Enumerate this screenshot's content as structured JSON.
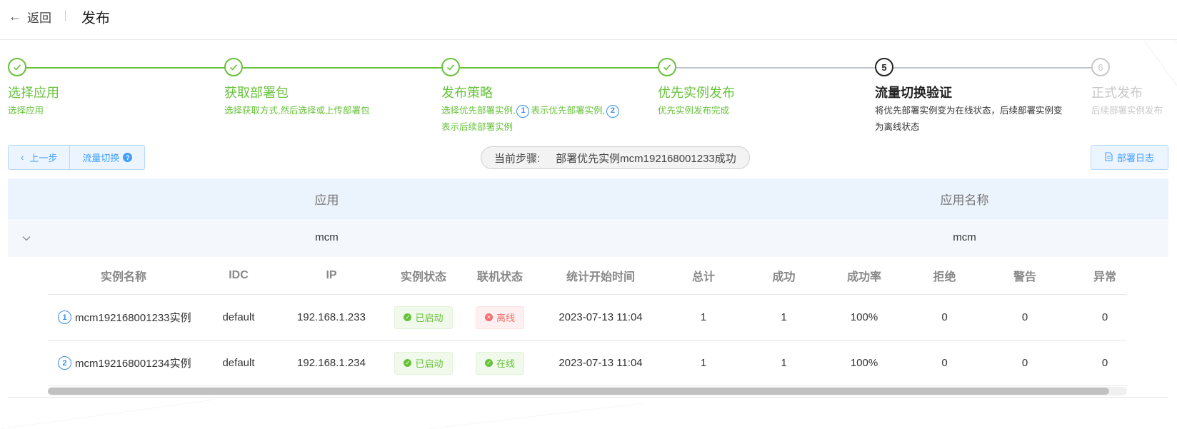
{
  "header": {
    "back_label": "返回",
    "title": "发布"
  },
  "steps": [
    {
      "title": "选择应用",
      "desc": "选择应用",
      "state": "done"
    },
    {
      "title": "获取部署包",
      "desc": "选择获取方式,然后选择或上传部署包",
      "state": "done"
    },
    {
      "title": "发布策略",
      "desc_a": "选择优先部署实例,",
      "badge1": "1",
      "desc_b": "表示优先部署实例,",
      "badge2": "2",
      "desc_c": "表示后续部署实例",
      "state": "done"
    },
    {
      "title": "优先实例发布",
      "desc": "优先实例发布完成",
      "state": "done"
    },
    {
      "number": "5",
      "title": "流量切换验证",
      "desc": "将优先部署实例变为在线状态，后续部署实例变为离线状态",
      "state": "active"
    },
    {
      "number": "6",
      "title": "正式发布",
      "desc": "后续部署实例发布",
      "state": "pending"
    }
  ],
  "toolbar": {
    "prev_label": "上一步",
    "traffic_label": "流量切换",
    "help_glyph": "?",
    "current_step_label": "当前步骤:",
    "current_step_value": "部署优先实例mcm192168001233成功",
    "log_label": "部署日志"
  },
  "outer_table": {
    "headers": [
      "应用",
      "应用名称"
    ],
    "row": [
      "mcm",
      "mcm"
    ]
  },
  "inner_table": {
    "headers": [
      "实例名称",
      "IDC",
      "IP",
      "实例状态",
      "联机状态",
      "统计开始时间",
      "总计",
      "成功",
      "成功率",
      "拒绝",
      "警告",
      "异常"
    ],
    "rows": [
      {
        "index": "1",
        "name": "mcm192168001233实例",
        "idc": "default",
        "ip": "192.168.1.233",
        "status": "已启动",
        "online": "离线",
        "online_type": "danger",
        "start": "2023-07-13 11:04",
        "total": "1",
        "success": "1",
        "rate": "100%",
        "reject": "0",
        "warn": "0",
        "error": "0"
      },
      {
        "index": "2",
        "name": "mcm192168001234实例",
        "idc": "default",
        "ip": "192.168.1.234",
        "status": "已启动",
        "online": "在线",
        "online_type": "success",
        "start": "2023-07-13 11:04",
        "total": "1",
        "success": "1",
        "rate": "100%",
        "reject": "0",
        "warn": "0",
        "error": "0"
      }
    ]
  },
  "colors": {
    "success": "#67c23a",
    "primary": "#409eff",
    "danger": "#f56c6c",
    "pending": "#c8c8c8"
  }
}
